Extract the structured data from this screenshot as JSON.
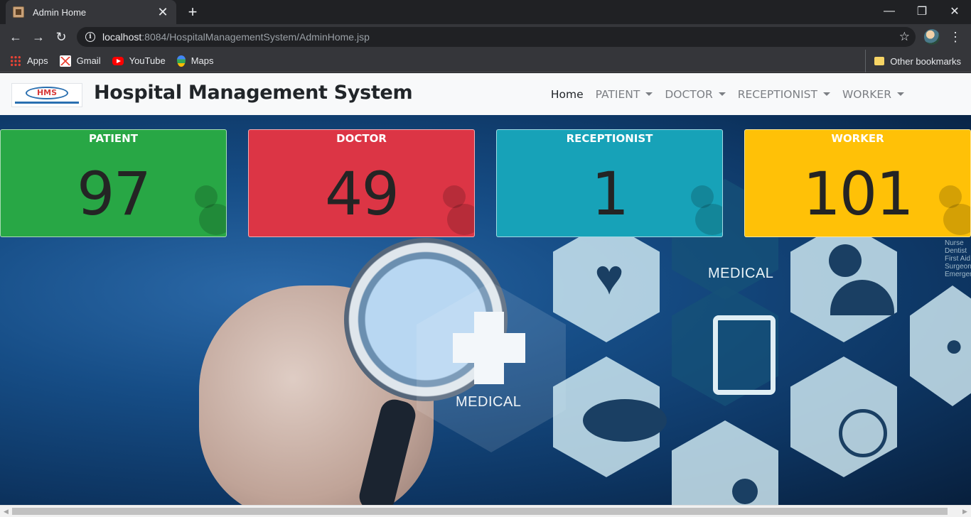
{
  "browser": {
    "tab_title": "Admin Home",
    "url_host": "localhost",
    "url_rest": ":8084/HospitalManagementSystem/AdminHome.jsp",
    "bookmarks": [
      "Apps",
      "Gmail",
      "YouTube",
      "Maps"
    ],
    "other_bookmarks": "Other bookmarks"
  },
  "site": {
    "brand_name": "Hospital Management System",
    "logo_text": "HMS",
    "nav": {
      "home": "Home",
      "patient": "PATIENT",
      "doctor": "DOCTOR",
      "receptionist": "RECEPTIONIST",
      "worker": "WORKER"
    }
  },
  "stats": [
    {
      "title": "PATIENT",
      "value": "97",
      "color": "#28a745"
    },
    {
      "title": "DOCTOR",
      "value": "49",
      "color": "#dc3545"
    },
    {
      "title": "RECEPTIONIST",
      "value": "1",
      "color": "#17a2b8"
    },
    {
      "title": "WORKER",
      "value": "101",
      "color": "#ffc107"
    }
  ],
  "hero": {
    "medical_main": "MEDICAL",
    "medical_top": "MEDICAL",
    "side_list": [
      "Nurse",
      "Dentist",
      "First Aid",
      "Surgeon",
      "Emergency"
    ]
  }
}
